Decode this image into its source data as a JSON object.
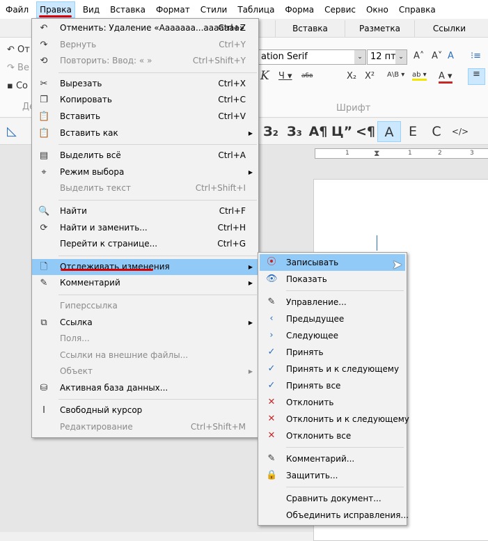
{
  "menubar": [
    "Файл",
    "Правка",
    "Вид",
    "Вставка",
    "Формат",
    "Стили",
    "Таблица",
    "Форма",
    "Сервис",
    "Окно",
    "Справка"
  ],
  "tabs": [
    "Вставка",
    "Разметка",
    "Ссылки"
  ],
  "ribbon": {
    "undo": "От",
    "redo": "Ве",
    "save": "Со",
    "group_left": "Де",
    "font_name": "ation Serif",
    "font_size": "12 пт",
    "group_font": "Шрифт",
    "styles": [
      "З₂",
      "З₃",
      "A¶",
      "Ц”",
      "<¶",
      "A",
      "E",
      "C",
      "</>"
    ],
    "ruler_ticks": [
      "1",
      "1",
      "2",
      "3"
    ]
  },
  "edit_menu": [
    {
      "label": "Отменить: Удаление «Ааааааа...ааааааа»",
      "shortcut": "Ctrl+Z",
      "icon": "undo-icon",
      "glyph": "↶"
    },
    {
      "label": "Вернуть",
      "shortcut": "Ctrl+Y",
      "icon": "redo-icon",
      "glyph": "↷",
      "disabled": true
    },
    {
      "label": "Повторить: Ввод: « »",
      "shortcut": "Ctrl+Shift+Y",
      "icon": "repeat-icon",
      "glyph": "⟲",
      "disabled": true
    },
    {
      "sep": true
    },
    {
      "label": "Вырезать",
      "shortcut": "Ctrl+X",
      "icon": "scissors-icon",
      "glyph": "✂"
    },
    {
      "label": "Копировать",
      "shortcut": "Ctrl+C",
      "icon": "copy-icon",
      "glyph": "❐"
    },
    {
      "label": "Вставить",
      "shortcut": "Ctrl+V",
      "icon": "paste-icon",
      "glyph": "📋"
    },
    {
      "label": "Вставить как",
      "icon": "paste-special-icon",
      "glyph": "📋",
      "submenu": true
    },
    {
      "sep": true
    },
    {
      "label": "Выделить всё",
      "shortcut": "Ctrl+A",
      "icon": "select-all-icon",
      "glyph": "▤"
    },
    {
      "label": "Режим выбора",
      "icon": "selection-mode-icon",
      "glyph": "⌖",
      "submenu": true
    },
    {
      "label": "Выделить текст",
      "shortcut": "Ctrl+Shift+I",
      "disabled": true
    },
    {
      "sep": true
    },
    {
      "label": "Найти",
      "shortcut": "Ctrl+F",
      "icon": "search-icon",
      "glyph": "🔍"
    },
    {
      "label": "Найти и заменить...",
      "shortcut": "Ctrl+H",
      "icon": "find-replace-icon",
      "glyph": "⟳"
    },
    {
      "label": "Перейти к странице...",
      "shortcut": "Ctrl+G"
    },
    {
      "sep": true
    },
    {
      "label": "Отслеживать изменения",
      "icon": "track-changes-icon",
      "glyph": "🗋",
      "submenu": true,
      "highlighted": true
    },
    {
      "label": "Комментарий",
      "icon": "comment-icon",
      "glyph": "✎",
      "submenu": true
    },
    {
      "sep": true
    },
    {
      "label": "Гиперссылка",
      "disabled": true
    },
    {
      "label": "Ссылка",
      "icon": "reference-icon",
      "glyph": "⧉",
      "submenu": true
    },
    {
      "label": "Поля...",
      "disabled": true
    },
    {
      "label": "Ссылки на внешние файлы...",
      "disabled": true
    },
    {
      "label": "Объект",
      "disabled": true,
      "submenu": true
    },
    {
      "label": "Активная база данных...",
      "icon": "database-icon",
      "glyph": "⛁"
    },
    {
      "sep": true
    },
    {
      "label": "Свободный курсор",
      "icon": "text-cursor-icon",
      "glyph": "I"
    },
    {
      "label": "Редактирование",
      "shortcut": "Ctrl+Shift+M",
      "disabled": true
    }
  ],
  "track_menu": [
    {
      "label": "Записывать",
      "icon": "record-icon",
      "glyph": "⦿",
      "highlighted": true
    },
    {
      "label": "Показать",
      "icon": "show-icon",
      "glyph": "👁"
    },
    {
      "sep": true
    },
    {
      "label": "Управление...",
      "icon": "manage-icon",
      "glyph": "✎"
    },
    {
      "label": "Предыдущее",
      "icon": "previous-icon",
      "glyph": "‹"
    },
    {
      "label": "Следующее",
      "icon": "next-icon",
      "glyph": "›"
    },
    {
      "label": "Принять",
      "icon": "accept-icon",
      "glyph": "✓"
    },
    {
      "label": "Принять и к следующему",
      "icon": "accept-next-icon",
      "glyph": "✓"
    },
    {
      "label": "Принять все",
      "icon": "accept-all-icon",
      "glyph": "✓"
    },
    {
      "label": "Отклонить",
      "icon": "reject-icon",
      "glyph": "✕"
    },
    {
      "label": "Отклонить и к следующему",
      "icon": "reject-next-icon",
      "glyph": "✕"
    },
    {
      "label": "Отклонить все",
      "icon": "reject-all-icon",
      "glyph": "✕"
    },
    {
      "sep": true
    },
    {
      "label": "Комментарий...",
      "icon": "comment-icon",
      "glyph": "✎"
    },
    {
      "label": "Защитить...",
      "icon": "protect-icon",
      "glyph": "🔒"
    },
    {
      "sep": true
    },
    {
      "label": "Сравнить документ..."
    },
    {
      "label": "Объединить исправления..."
    }
  ],
  "colors": {
    "highlight": "#91c9f7",
    "annotation": "#dd0000",
    "accept": "#2a6ebb",
    "reject": "#c62828"
  }
}
